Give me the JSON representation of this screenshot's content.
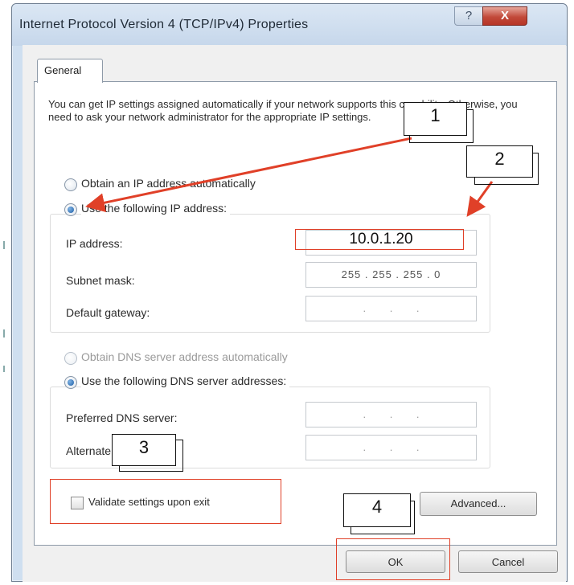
{
  "window": {
    "title": "Internet Protocol Version 4 (TCP/IPv4) Properties",
    "help_label": "?",
    "close_label": "X"
  },
  "tabs": [
    {
      "label": "General"
    }
  ],
  "description": "You can get IP settings assigned automatically if your network supports this capability. Otherwise, you need to ask your network administrator for the appropriate IP settings.",
  "ip_section": {
    "auto_label": "Obtain an IP address automatically",
    "manual_label": "Use the following IP address:",
    "selected": "manual",
    "fields": [
      {
        "label": "IP address:",
        "value": "10.0.1.20"
      },
      {
        "label": "Subnet mask:",
        "value": "255 . 255 . 255 . 0"
      },
      {
        "label": "Default gateway:",
        "value": ". . ."
      }
    ]
  },
  "dns_section": {
    "auto_label": "Obtain DNS server address automatically",
    "manual_label": "Use the following DNS server addresses:",
    "selected": "manual",
    "fields": [
      {
        "label": "Preferred DNS server:",
        "value": ". . ."
      },
      {
        "label": "Alternate DNS server:",
        "value": ". . ."
      }
    ]
  },
  "validate": {
    "label": "Validate settings upon exit",
    "checked": false
  },
  "buttons": {
    "advanced": "Advanced...",
    "ok": "OK",
    "cancel": "Cancel"
  },
  "annotations": [
    "1",
    "2",
    "3",
    "4"
  ],
  "colors": {
    "annotation_red": "#e04028",
    "title_bar": "#cfdff0",
    "radio_selected": "#1d5fa6"
  }
}
